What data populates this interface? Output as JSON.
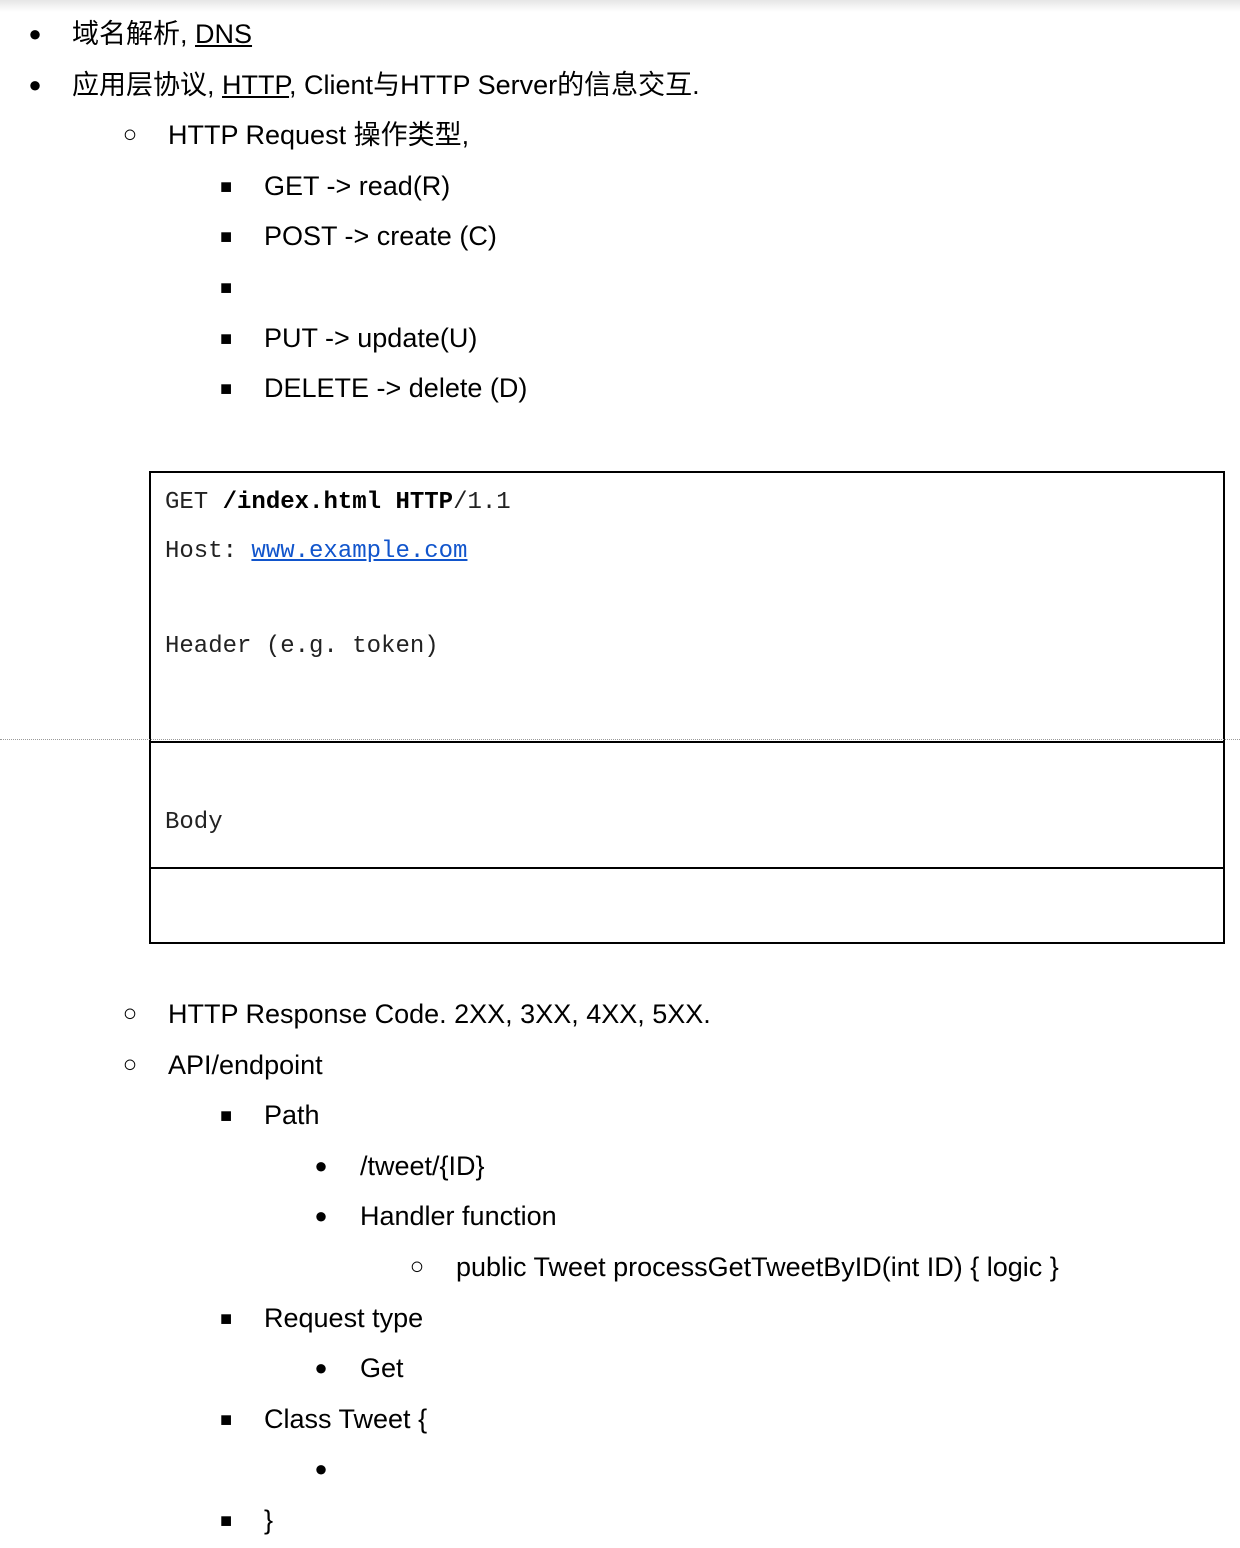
{
  "list_top": [
    {
      "level": 1,
      "marker": "disc",
      "parts": [
        {
          "text": "域名解析, "
        },
        {
          "text": "DNS",
          "link": true
        }
      ]
    },
    {
      "level": 1,
      "marker": "disc",
      "parts": [
        {
          "text": "应用层协议, "
        },
        {
          "text": "HTTP",
          "link": true
        },
        {
          "text": ", Client与HTTP Server的信息交互."
        }
      ]
    },
    {
      "level": 2,
      "marker": "circle",
      "parts": [
        {
          "text": "HTTP Request 操作类型,"
        }
      ]
    },
    {
      "level": 3,
      "marker": "square",
      "parts": [
        {
          "text": "GET -> read(R)"
        }
      ]
    },
    {
      "level": 3,
      "marker": "square",
      "parts": [
        {
          "text": "POST -> create (C)"
        }
      ]
    },
    {
      "level": 3,
      "marker": "square",
      "parts": [
        {
          "text": ""
        }
      ]
    },
    {
      "level": 3,
      "marker": "square",
      "parts": [
        {
          "text": "PUT -> update(U)"
        }
      ]
    },
    {
      "level": 3,
      "marker": "square",
      "parts": [
        {
          "text": "DELETE -> delete (D)"
        }
      ]
    }
  ],
  "code_block": {
    "method": "GET",
    "path": "/index.html",
    "protocol": "HTTP",
    "version": "/1.1",
    "host_label": "Host: ",
    "host_url": "www.example.com",
    "header_note": "Header (e.g. token)",
    "body_note": "Body"
  },
  "list_bottom": [
    {
      "level": 2,
      "marker": "circle",
      "parts": [
        {
          "text": "HTTP Response Code. 2XX, 3XX, 4XX, 5XX."
        }
      ]
    },
    {
      "level": 2,
      "marker": "circle",
      "parts": [
        {
          "text": "API/endpoint"
        }
      ]
    },
    {
      "level": 3,
      "marker": "square",
      "parts": [
        {
          "text": "Path"
        }
      ]
    },
    {
      "level": 4,
      "marker": "disc",
      "parts": [
        {
          "text": "/tweet/{ID}"
        }
      ]
    },
    {
      "level": 4,
      "marker": "disc",
      "parts": [
        {
          "text": "Handler function"
        }
      ]
    },
    {
      "level": 5,
      "marker": "circle",
      "parts": [
        {
          "text": "public Tweet processGetTweetByID(int ID) { logic }"
        }
      ]
    },
    {
      "level": 3,
      "marker": "square",
      "parts": [
        {
          "text": "Request type"
        }
      ]
    },
    {
      "level": 4,
      "marker": "disc",
      "parts": [
        {
          "text": "Get"
        }
      ]
    },
    {
      "level": 3,
      "marker": "square",
      "parts": [
        {
          "text": "Class Tweet {"
        }
      ]
    },
    {
      "level": 4,
      "marker": "disc",
      "parts": [
        {
          "text": ""
        }
      ]
    },
    {
      "level": 3,
      "marker": "square",
      "parts": [
        {
          "text": "}"
        }
      ]
    }
  ]
}
